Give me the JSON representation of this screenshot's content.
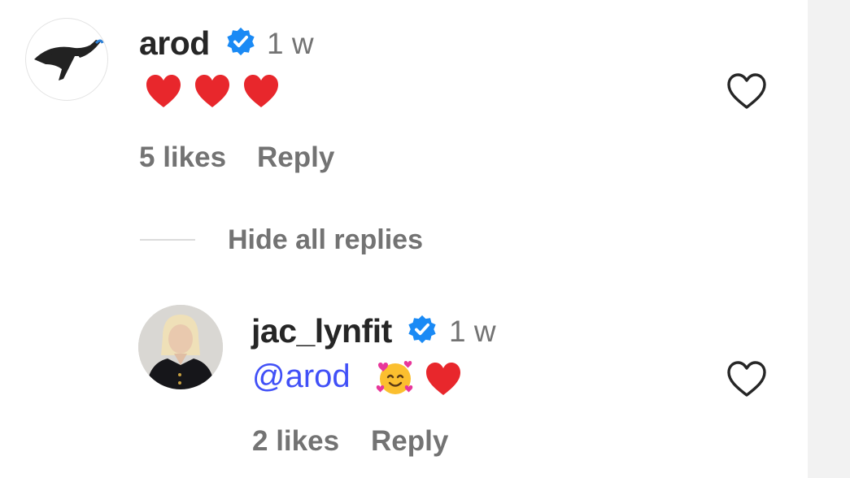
{
  "comment": {
    "username": "arod",
    "timestamp": "1 w",
    "text_emoji": [
      "red-heart",
      "red-heart",
      "red-heart"
    ],
    "likes": "5 likes",
    "reply_label": "Reply"
  },
  "replies_toggle": {
    "label": "Hide all replies"
  },
  "reply": {
    "username": "jac_lynfit",
    "timestamp": "1 w",
    "mention": "@arod",
    "text_emoji": [
      "smiling-face-with-hearts",
      "red-heart"
    ],
    "likes": "2 likes",
    "reply_label": "Reply"
  },
  "colors": {
    "verified_badge": "#1a8af5",
    "heart_emoji": "#e8272c",
    "mention": "#4150f7",
    "secondary_text": "#737373"
  }
}
